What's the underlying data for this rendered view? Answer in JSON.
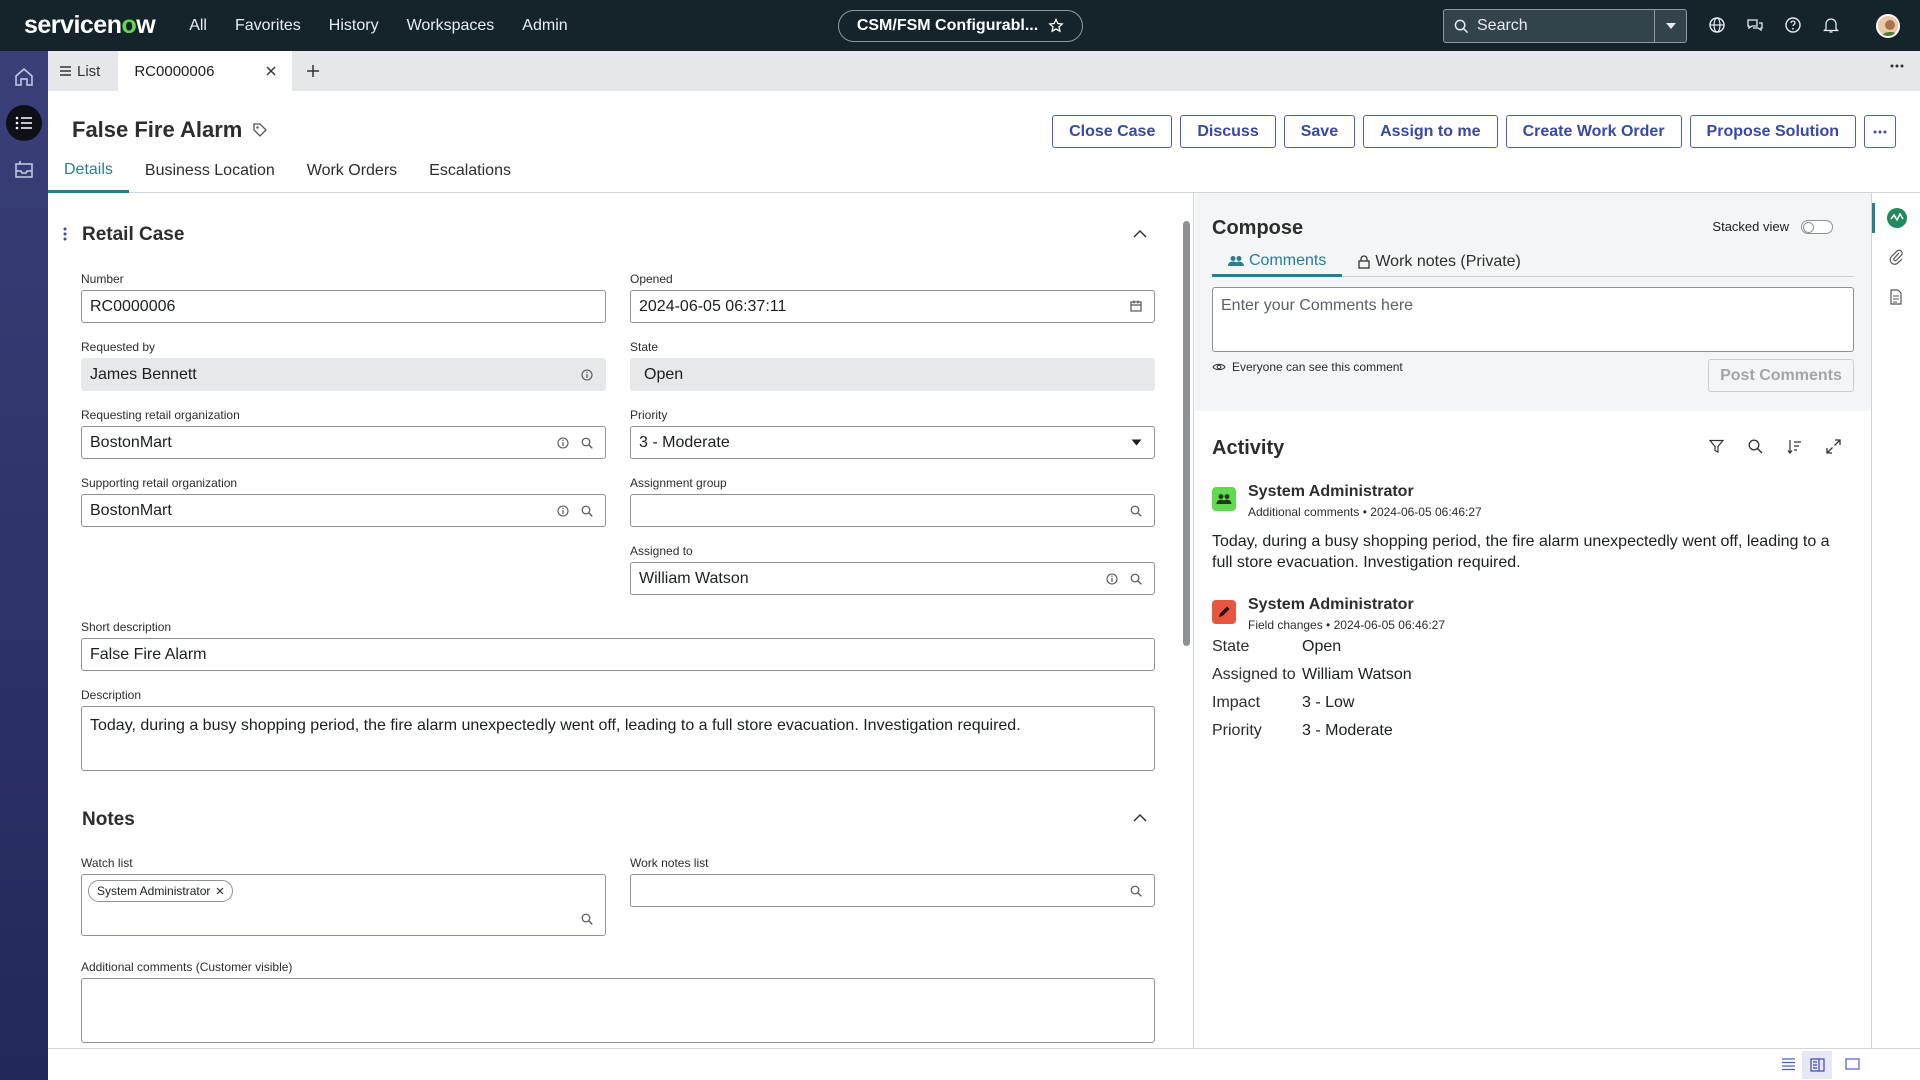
{
  "app": {
    "brand": "servicenow",
    "nav": [
      "All",
      "Favorites",
      "History",
      "Workspaces",
      "Admin"
    ],
    "context": "CSM/FSM Configurabl...",
    "search_placeholder": "Search"
  },
  "tabs": {
    "list": "List",
    "record": "RC0000006"
  },
  "record": {
    "title": "False Fire Alarm",
    "actions": [
      "Close Case",
      "Discuss",
      "Save",
      "Assign to me",
      "Create Work Order",
      "Propose Solution"
    ],
    "form_tabs": [
      "Details",
      "Business Location",
      "Work Orders",
      "Escalations"
    ]
  },
  "form": {
    "section_title": "Retail Case",
    "number": {
      "label": "Number",
      "value": "RC0000006"
    },
    "opened": {
      "label": "Opened",
      "value": "2024-06-05 06:37:11"
    },
    "requested_by": {
      "label": "Requested by",
      "value": "James Bennett"
    },
    "state": {
      "label": "State",
      "value": "Open"
    },
    "req_org": {
      "label": "Requesting retail organization",
      "value": "BostonMart"
    },
    "priority": {
      "label": "Priority",
      "value": "3 - Moderate"
    },
    "sup_org": {
      "label": "Supporting retail organization",
      "value": "BostonMart"
    },
    "assignment_group": {
      "label": "Assignment group",
      "value": ""
    },
    "assigned_to": {
      "label": "Assigned to",
      "value": "William Watson"
    },
    "short_desc": {
      "label": "Short description",
      "value": "False Fire Alarm"
    },
    "description": {
      "label": "Description",
      "value": "Today, during a busy shopping period, the fire alarm unexpectedly went off, leading to a full store evacuation. Investigation required."
    },
    "notes_title": "Notes",
    "watch_list": {
      "label": "Watch list",
      "chip": "System Administrator"
    },
    "work_notes_list": {
      "label": "Work notes list"
    },
    "add_comments": {
      "label": "Additional comments (Customer visible)"
    }
  },
  "compose": {
    "title": "Compose",
    "stacked": "Stacked view",
    "tab_comments": "Comments",
    "tab_worknotes": "Work notes (Private)",
    "placeholder": "Enter your Comments here",
    "visibility": "Everyone can see this comment",
    "post": "Post Comments"
  },
  "activity": {
    "title": "Activity",
    "e1": {
      "name": "System Administrator",
      "type": "Additional comments",
      "time": "2024-06-05 06:46:27",
      "text": "Today, during a busy shopping period, the fire alarm unexpectedly went off, leading to a full store evacuation. Investigation required."
    },
    "e2": {
      "name": "System Administrator",
      "type": "Field changes",
      "time": "2024-06-05 06:46:27",
      "fields": [
        {
          "k": "State",
          "v": "Open"
        },
        {
          "k": "Assigned to",
          "v": "William Watson"
        },
        {
          "k": "Impact",
          "v": "3 - Low"
        },
        {
          "k": "Priority",
          "v": "3 - Moderate"
        }
      ]
    }
  },
  "colors": {
    "topbar": "#15232b",
    "accent": "#2b7d92",
    "button": "#3848a6",
    "comment_avatar": "#62d84e",
    "change_avatar": "#e8553e"
  }
}
